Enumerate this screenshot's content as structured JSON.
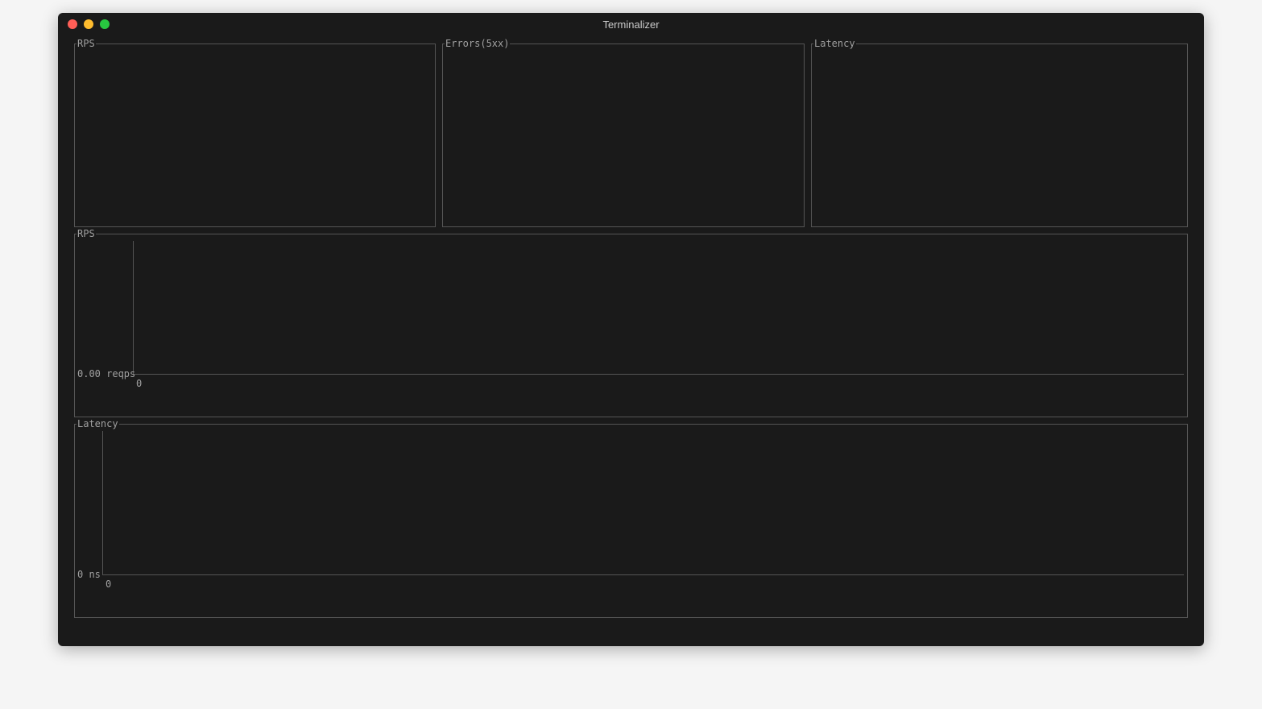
{
  "window": {
    "title": "Terminalizer"
  },
  "panels": {
    "top": [
      {
        "label": "RPS"
      },
      {
        "label": "Errors(5xx)"
      },
      {
        "label": "Latency"
      }
    ],
    "rps_chart": {
      "label": "RPS",
      "y_value": "0.00 reqps",
      "x_value": "0"
    },
    "latency_chart": {
      "label": "Latency",
      "y_value": "0 ns",
      "x_value": "0"
    }
  },
  "chart_data": [
    {
      "type": "line",
      "title": "RPS",
      "xlabel": "",
      "ylabel": "reqps",
      "x": [
        0
      ],
      "values": [
        0.0
      ],
      "ylim": [
        0,
        0
      ],
      "series_name": "RPS"
    },
    {
      "type": "line",
      "title": "Latency",
      "xlabel": "",
      "ylabel": "ns",
      "x": [
        0
      ],
      "values": [
        0
      ],
      "ylim": [
        0,
        0
      ],
      "series_name": "Latency"
    }
  ]
}
